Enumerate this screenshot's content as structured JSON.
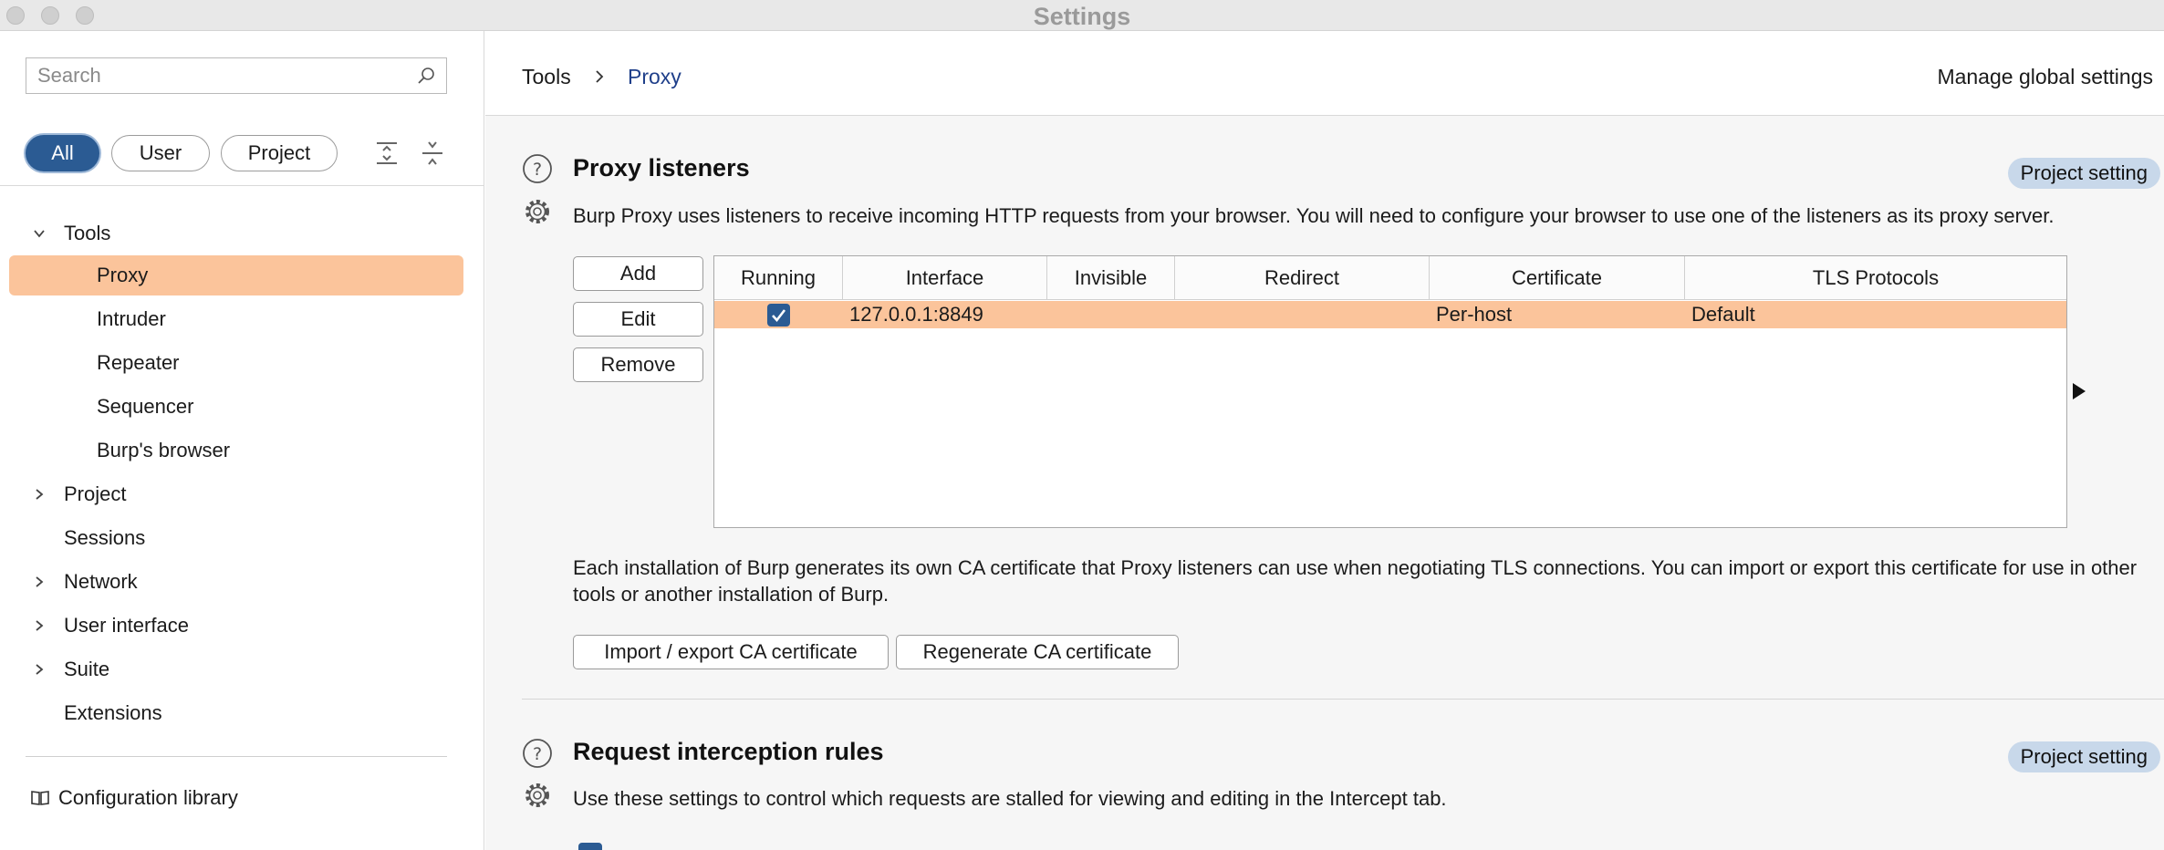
{
  "window": {
    "title": "Settings"
  },
  "sidebar": {
    "search_placeholder": "Search",
    "filters": [
      {
        "label": "All",
        "active": true
      },
      {
        "label": "User",
        "active": false
      },
      {
        "label": "Project",
        "active": false
      }
    ],
    "tree": [
      {
        "label": "Tools",
        "expanded": true
      },
      {
        "label": "Proxy",
        "selected": true
      },
      {
        "label": "Intruder"
      },
      {
        "label": "Repeater"
      },
      {
        "label": "Sequencer"
      },
      {
        "label": "Burp's browser"
      },
      {
        "label": "Project",
        "expanded": false
      },
      {
        "label": "Sessions"
      },
      {
        "label": "Network",
        "expanded": false
      },
      {
        "label": "User interface",
        "expanded": false
      },
      {
        "label": "Suite",
        "expanded": false
      },
      {
        "label": "Extensions"
      }
    ],
    "config_library": "Configuration library"
  },
  "header": {
    "breadcrumb": [
      "Tools",
      "Proxy"
    ],
    "manage_global": "Manage global settings"
  },
  "proxy_listeners": {
    "title": "Proxy listeners",
    "badge": "Project setting",
    "description": "Burp Proxy uses listeners to receive incoming HTTP requests from your browser. You will need to configure your browser to use one of the listeners as its proxy server.",
    "buttons": {
      "add": "Add",
      "edit": "Edit",
      "remove": "Remove"
    },
    "table": {
      "columns": [
        "Running",
        "Interface",
        "Invisible",
        "Redirect",
        "Certificate",
        "TLS Protocols"
      ],
      "rows": [
        {
          "running": true,
          "interface": "127.0.0.1:8849",
          "invisible": "",
          "redirect": "",
          "certificate": "Per-host",
          "tls_protocols": "Default"
        }
      ]
    },
    "ca_text": "Each installation of Burp generates its own CA certificate that Proxy listeners can use when negotiating TLS connections. You can import or export this certificate for use in other tools or another installation of Burp.",
    "ca_buttons": {
      "import_export": "Import / export CA certificate",
      "regenerate": "Regenerate CA certificate"
    }
  },
  "request_interception": {
    "title": "Request interception rules",
    "badge": "Project setting",
    "description": "Use these settings to control which requests are stalled for viewing and editing in the Intercept tab."
  },
  "colors": {
    "accent": "#2b5b93",
    "selection": "#fbc49b",
    "badge": "#c8d8ea"
  }
}
